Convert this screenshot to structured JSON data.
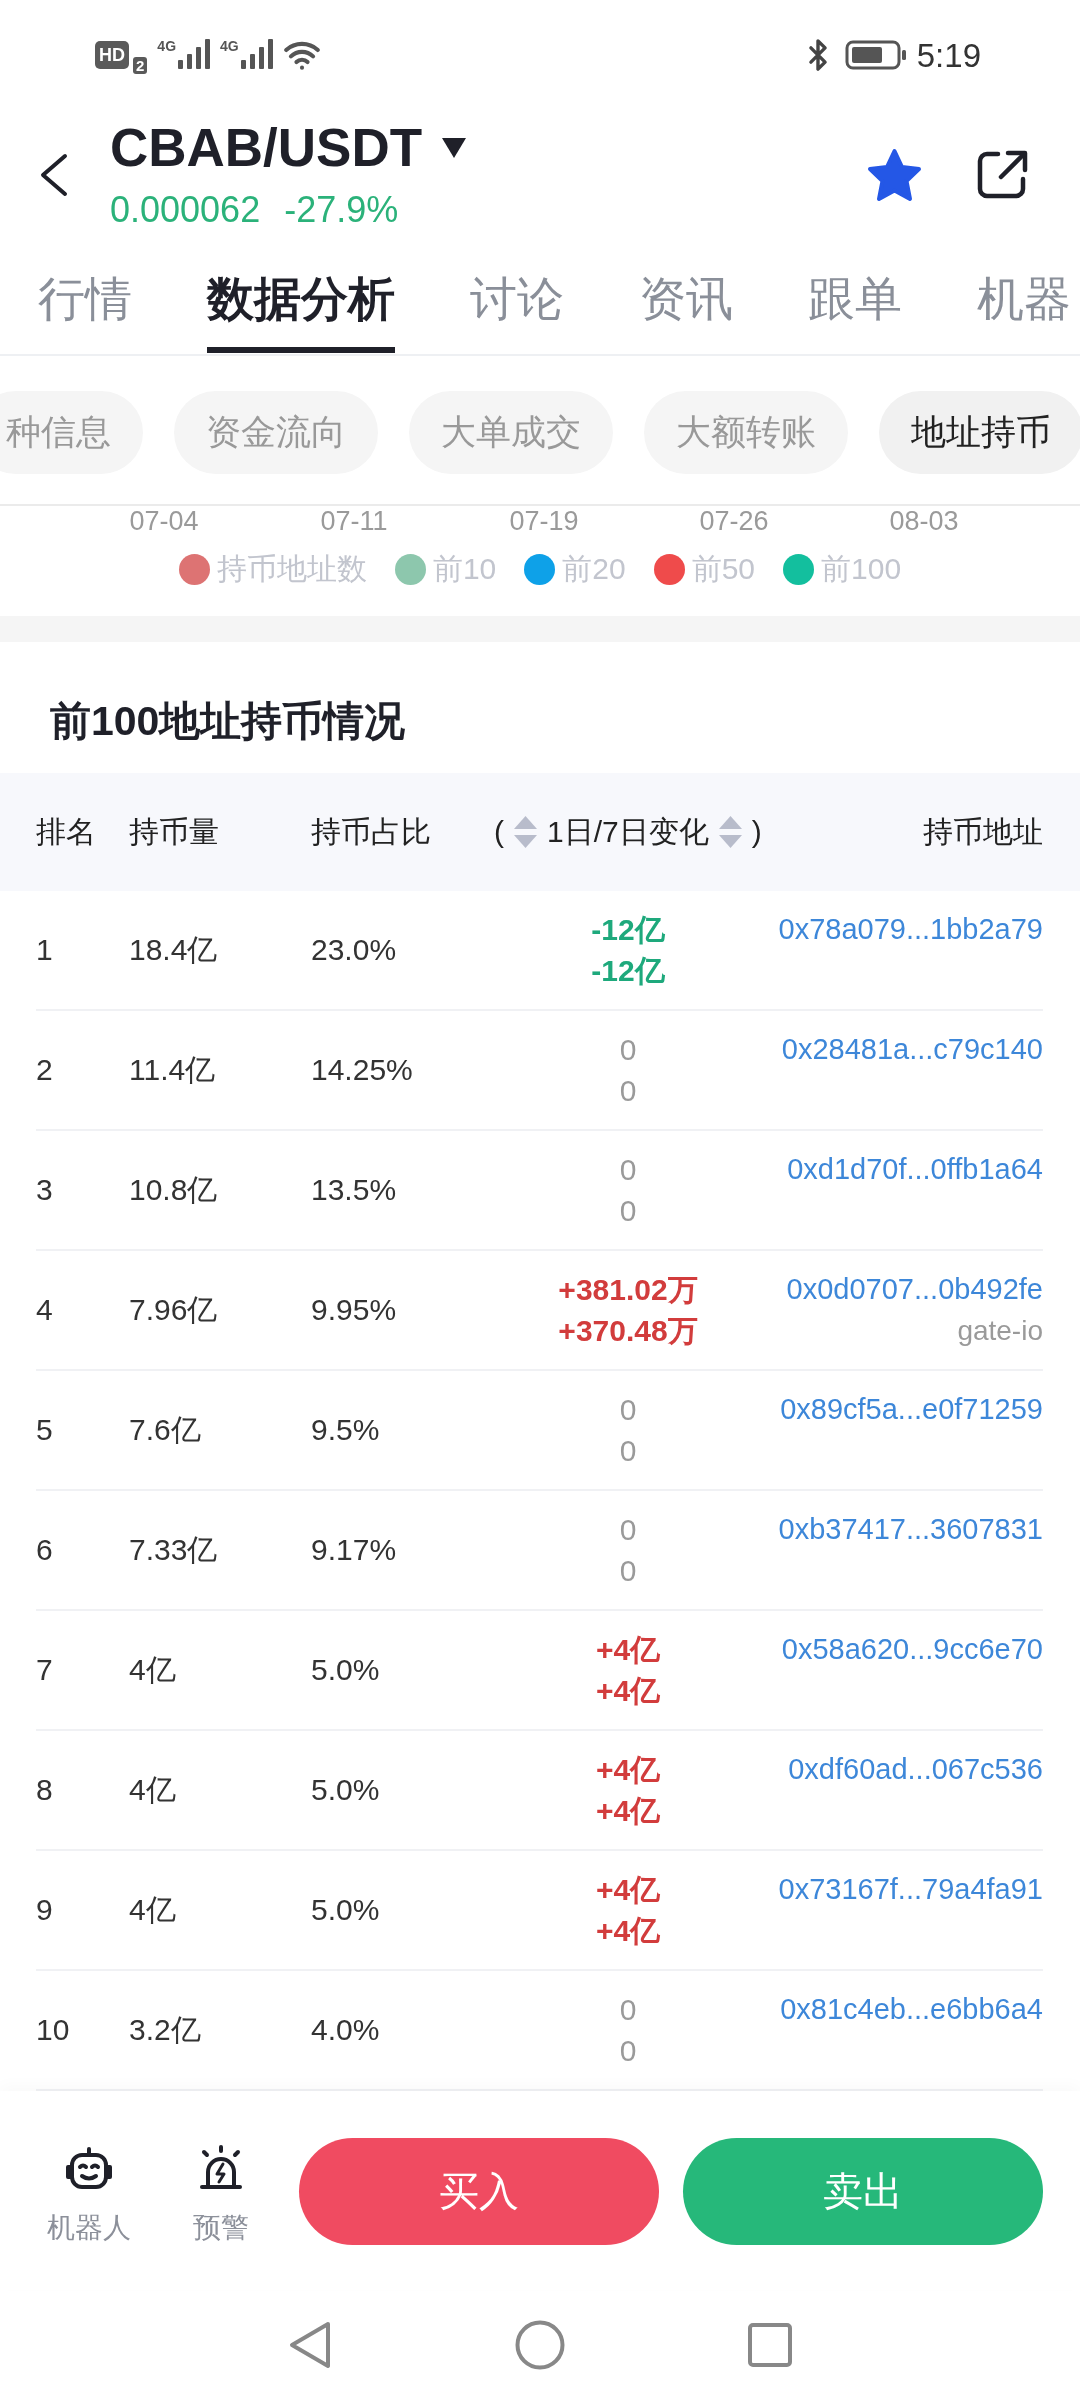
{
  "status_bar": {
    "hd": "HD",
    "sim": "2",
    "networks": [
      "4G",
      "4G"
    ],
    "time": "5:19"
  },
  "header": {
    "pair": "CBAB/USDT",
    "quote": [
      {
        "value": "0.000062",
        "kind": "down"
      },
      {
        "value": "-27.9%",
        "kind": "down"
      }
    ],
    "favorite": true
  },
  "tabs": [
    {
      "label": "行情",
      "selected": false
    },
    {
      "label": "数据分析",
      "selected": true
    },
    {
      "label": "讨论",
      "selected": false
    },
    {
      "label": "资讯",
      "selected": false
    },
    {
      "label": "跟单",
      "selected": false
    },
    {
      "label": "机器",
      "selected": false
    }
  ],
  "sub_tabs": [
    {
      "label": "种信息",
      "selected": false
    },
    {
      "label": "资金流向",
      "selected": false
    },
    {
      "label": "大单成交",
      "selected": false
    },
    {
      "label": "大额转账",
      "selected": false
    },
    {
      "label": "地址持币",
      "selected": true
    }
  ],
  "chart": {
    "x_labels": [
      "07-04",
      "07-11",
      "07-19",
      "07-26",
      "08-03"
    ],
    "legend": [
      {
        "label": "持币地址数",
        "color": "#dd7373"
      },
      {
        "label": "前10",
        "color": "#8dc7ad"
      },
      {
        "label": "前20",
        "color": "#0ea1e8"
      },
      {
        "label": "前50",
        "color": "#ef4b4b"
      },
      {
        "label": "前100",
        "color": "#13bf9e"
      }
    ]
  },
  "holders": {
    "title": "前100地址持币情况",
    "columns": [
      {
        "label": "排名",
        "kind": "plain"
      },
      {
        "label": "持币量",
        "kind": "plain"
      },
      {
        "label": "持币占比",
        "kind": "plain"
      },
      {
        "label": "1日/7日变化",
        "kind": "sortable",
        "open": "(",
        "close": ")"
      },
      {
        "label": "持币地址",
        "kind": "end"
      }
    ],
    "rows": [
      {
        "rank": "1",
        "amount": "18.4亿",
        "share": "23.0%",
        "changes": [
          {
            "value": "-12亿",
            "kind": "down"
          },
          {
            "value": "-12亿",
            "kind": "down"
          }
        ],
        "address": "0x78a079...1bb2a79"
      },
      {
        "rank": "2",
        "amount": "11.4亿",
        "share": "14.25%",
        "changes": [
          {
            "value": "0",
            "kind": "flat"
          },
          {
            "value": "0",
            "kind": "flat"
          }
        ],
        "address": "0x28481a...c79c140"
      },
      {
        "rank": "3",
        "amount": "10.8亿",
        "share": "13.5%",
        "changes": [
          {
            "value": "0",
            "kind": "flat"
          },
          {
            "value": "0",
            "kind": "flat"
          }
        ],
        "address": "0xd1d70f...0ffb1a64"
      },
      {
        "rank": "4",
        "amount": "7.96亿",
        "share": "9.95%",
        "changes": [
          {
            "value": "+381.02万",
            "kind": "up"
          },
          {
            "value": "+370.48万",
            "kind": "up"
          }
        ],
        "address": "0x0d0707...0b492fe",
        "tag": "gate-io"
      },
      {
        "rank": "5",
        "amount": "7.6亿",
        "share": "9.5%",
        "changes": [
          {
            "value": "0",
            "kind": "flat"
          },
          {
            "value": "0",
            "kind": "flat"
          }
        ],
        "address": "0x89cf5a...e0f71259"
      },
      {
        "rank": "6",
        "amount": "7.33亿",
        "share": "9.17%",
        "changes": [
          {
            "value": "0",
            "kind": "flat"
          },
          {
            "value": "0",
            "kind": "flat"
          }
        ],
        "address": "0xb37417...3607831"
      },
      {
        "rank": "7",
        "amount": "4亿",
        "share": "5.0%",
        "changes": [
          {
            "value": "+4亿",
            "kind": "up"
          },
          {
            "value": "+4亿",
            "kind": "up"
          }
        ],
        "address": "0x58a620...9cc6e70"
      },
      {
        "rank": "8",
        "amount": "4亿",
        "share": "5.0%",
        "changes": [
          {
            "value": "+4亿",
            "kind": "up"
          },
          {
            "value": "+4亿",
            "kind": "up"
          }
        ],
        "address": "0xdf60ad...067c536"
      },
      {
        "rank": "9",
        "amount": "4亿",
        "share": "5.0%",
        "changes": [
          {
            "value": "+4亿",
            "kind": "up"
          },
          {
            "value": "+4亿",
            "kind": "up"
          }
        ],
        "address": "0x73167f...79a4fa91"
      },
      {
        "rank": "10",
        "amount": "3.2亿",
        "share": "4.0%",
        "changes": [
          {
            "value": "0",
            "kind": "flat"
          },
          {
            "value": "0",
            "kind": "flat"
          }
        ],
        "address": "0x81c4eb...e6bb6a4"
      }
    ]
  },
  "trade_bar": {
    "shortcuts": [
      {
        "label": "机器人",
        "kind": "robot"
      },
      {
        "label": "预警",
        "kind": "alert"
      }
    ],
    "buttons": [
      {
        "label": "买入",
        "kind": "buy"
      },
      {
        "label": "卖出",
        "kind": "sell"
      }
    ]
  }
}
